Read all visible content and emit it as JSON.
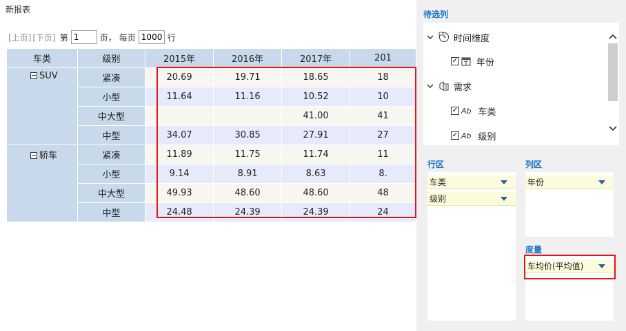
{
  "report": {
    "title": "新报表",
    "pager": {
      "prev": "[上页]",
      "next": "[下页]",
      "page_prefix": "第",
      "page_value": "1",
      "page_suffix": "页，",
      "per_page_prefix": "每页",
      "per_page_value": "1000",
      "per_page_suffix": "行"
    },
    "table": {
      "headers": [
        "车类",
        "级别",
        "2015年",
        "2016年",
        "2017年",
        "201"
      ],
      "groups": [
        {
          "name": "SUV",
          "rows": [
            {
              "level": "紧凑",
              "values": [
                "20.69",
                "19.71",
                "18.65",
                "18"
              ]
            },
            {
              "level": "小型",
              "values": [
                "11.64",
                "11.16",
                "10.52",
                "10"
              ]
            },
            {
              "level": "中大型",
              "values": [
                "",
                "",
                "41.00",
                "41"
              ]
            },
            {
              "level": "中型",
              "values": [
                "34.07",
                "30.85",
                "27.91",
                "27"
              ]
            }
          ]
        },
        {
          "name": "轿车",
          "rows": [
            {
              "level": "紧凑",
              "values": [
                "11.89",
                "11.75",
                "11.74",
                "11"
              ]
            },
            {
              "level": "小型",
              "values": [
                "9.14",
                "8.91",
                "8.63",
                "8."
              ]
            },
            {
              "level": "中大型",
              "values": [
                "49.93",
                "48.60",
                "48.60",
                "48"
              ]
            },
            {
              "level": "中型",
              "values": [
                "24.48",
                "24.39",
                "24.39",
                "24"
              ]
            }
          ]
        }
      ]
    }
  },
  "panel": {
    "candidate_title": "待选列",
    "tree": [
      {
        "label": "时间维度",
        "icon": "time-dimension-icon",
        "checked": null,
        "level": 0
      },
      {
        "label": "年份",
        "icon": "calendar-icon",
        "checked": true,
        "level": 1
      },
      {
        "label": "需求",
        "icon": "folder-icon",
        "checked": null,
        "level": 0
      },
      {
        "label": "车类",
        "icon": "text-field-icon",
        "checked": true,
        "level": 1
      },
      {
        "label": "级别",
        "icon": "text-field-icon",
        "checked": true,
        "level": 1
      }
    ],
    "row_area": {
      "title": "行区",
      "items": [
        "车类",
        "级别"
      ]
    },
    "col_area": {
      "title": "列区",
      "items": [
        "年份"
      ]
    },
    "measure_area": {
      "title": "度量",
      "items": [
        "车均价(平均值)"
      ]
    }
  },
  "colors": {
    "accent": "#1a73c8",
    "highlight_border": "#e0161c",
    "header_bg": "#c7d9ea",
    "chip_bg": "#fdfbdd"
  }
}
